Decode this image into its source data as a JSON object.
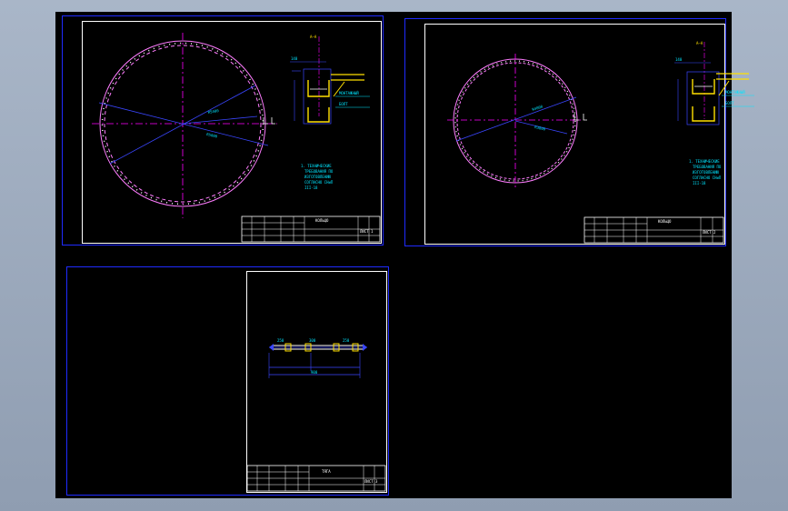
{
  "colors": {
    "background": "#000000",
    "sheet_border": "#1f2bff",
    "frame": "#ffffff",
    "ring": "#ff7cff",
    "centerline": "#ff00ff",
    "dimension": "#3a46ff",
    "detail": "#ffe000",
    "annotation": "#00e5ff"
  },
  "sheets": [
    {
      "id": "sheet-1",
      "section_label": "A—A",
      "notes": [
        "1. ТЕХНИЧЕСКИЕ",
        "ТРЕБОВАНИЯ ПО",
        "ИЗГОТОВЛЕНИЮ",
        "СОГЛАСНО СНиП",
        "III-18"
      ],
      "title_block": {
        "name": "КОЛЬЦО",
        "sheet": "ЛИСТ 1"
      }
    },
    {
      "id": "sheet-2",
      "section_label": "A—A",
      "notes": [
        "1. ТЕХНИЧЕСКИЕ",
        "ТРЕБОВАНИЯ ПО",
        "ИЗГОТОВЛЕНИЮ",
        "СОГЛАСНО СНиП",
        "III-18"
      ],
      "title_block": {
        "name": "КОЛЬЦО",
        "sheet": "ЛИСТ 2"
      }
    },
    {
      "id": "sheet-3",
      "title_block": {
        "name": "ТЯГА",
        "sheet": "ЛИСТ 3"
      }
    }
  ]
}
